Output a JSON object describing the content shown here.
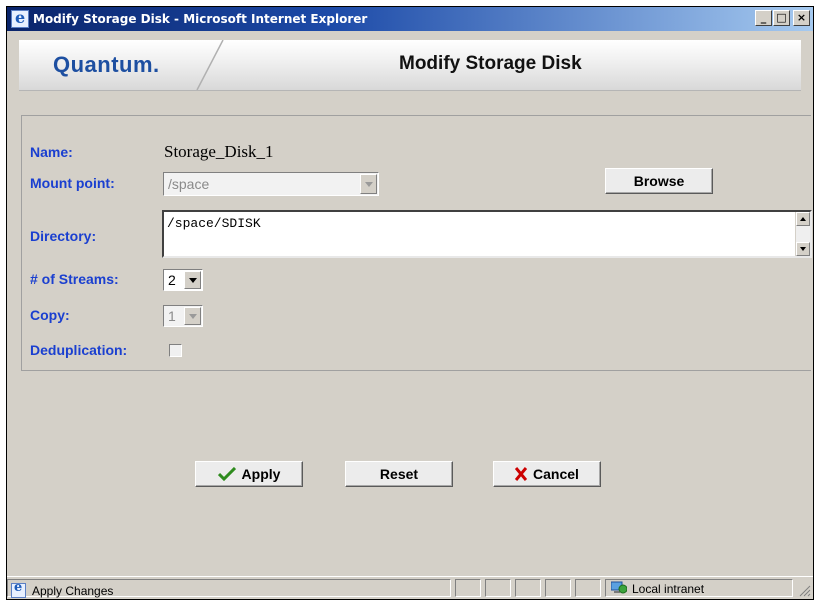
{
  "window": {
    "title": "Modify Storage Disk - Microsoft Internet Explorer",
    "minimize_glyph": "_",
    "maximize_glyph": "□",
    "close_glyph": "×"
  },
  "header": {
    "logo_text": "Quantum.",
    "page_title": "Modify Storage Disk"
  },
  "form": {
    "name_label": "Name:",
    "name_value": "Storage_Disk_1",
    "mount_label": "Mount point:",
    "mount_value": "/space",
    "browse_label": "Browse",
    "directory_label": "Directory:",
    "directory_value": "/space/SDISK",
    "streams_label": "# of Streams:",
    "streams_value": "2",
    "copy_label": "Copy:",
    "copy_value": "1",
    "dedup_label": "Deduplication:",
    "dedup_checked": false
  },
  "actions": {
    "apply_label": "Apply",
    "reset_label": "Reset",
    "cancel_label": "Cancel"
  },
  "statusbar": {
    "status_text": "Apply Changes",
    "zone_text": "Local intranet"
  },
  "colors": {
    "label_blue": "#1a3fd0",
    "logo_blue": "#1d4fa1",
    "apply_check_green": "#2e8b1e",
    "cancel_x_red": "#cc0000"
  }
}
